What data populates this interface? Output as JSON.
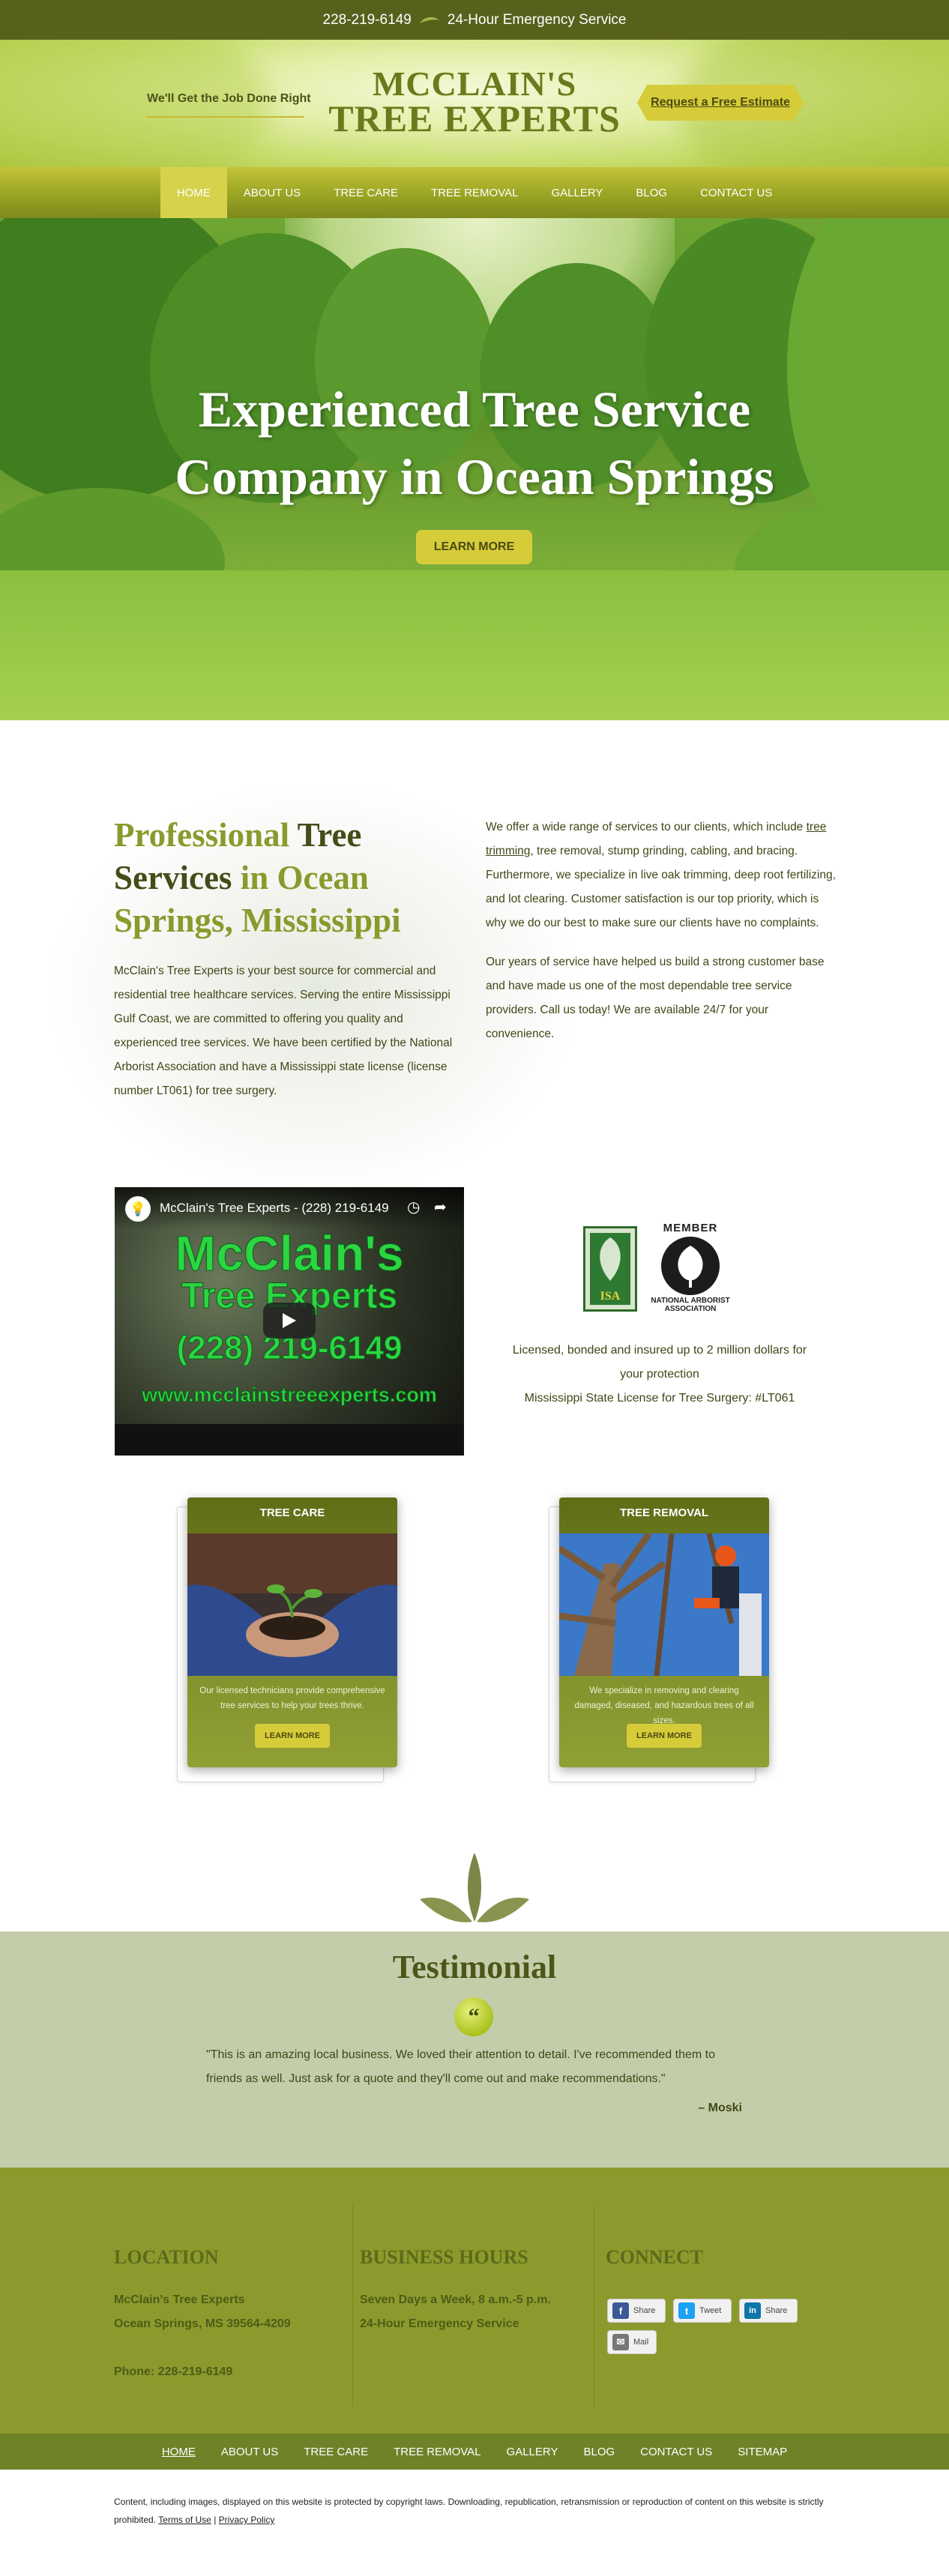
{
  "topbar": {
    "phone": "228-219-6149",
    "emergency": "24-Hour Emergency Service"
  },
  "header": {
    "tagline": "We'll Get the Job Done Right",
    "logo_line1": "MCCLAIN'S",
    "logo_line2": "TREE EXPERTS",
    "estimate_button": "Request a Free Estimate"
  },
  "nav": {
    "items": [
      {
        "label": "HOME",
        "active": true
      },
      {
        "label": "ABOUT US"
      },
      {
        "label": "TREE CARE"
      },
      {
        "label": "TREE REMOVAL"
      },
      {
        "label": "GALLERY"
      },
      {
        "label": "BLOG"
      },
      {
        "label": "CONTACT US"
      }
    ]
  },
  "hero": {
    "title_line1": "Experienced Tree Service",
    "title_line2": "Company in Ocean Springs",
    "button": "LEARN MORE"
  },
  "intro": {
    "heading_part1": "Professional ",
    "heading_part2": "Tree Services",
    "heading_part3": " in Ocean Springs, Mississippi",
    "left_paragraph": "McClain's Tree Experts is your best source for commercial and residential tree healthcare services. Serving the entire Mississippi Gulf Coast, we are committed to offering you quality and experienced tree services. We have been certified by the National Arborist Association and have a Mississippi state license (license number LT061) for tree surgery.",
    "right_p1_before": "We offer a wide range of services to our clients, which include ",
    "right_p1_link": "tree trimming",
    "right_p1_after": ", tree removal, stump grinding, cabling, and bracing. Furthermore, we specialize in live oak trimming, deep root fertilizing, and lot clearing. Customer satisfaction is our top priority, which is why we do our best to make sure our clients have no complaints.",
    "right_p2": "Our years of service have helped us build a strong customer base and have made us one of the most dependable tree service providers. Call us today! We are available 24/7 for your convenience."
  },
  "video": {
    "title": "McClain's Tree Experts - (228) 219-6149",
    "line1": "McClain's",
    "line2": "Tree Experts",
    "line3": "(228) 219-6149",
    "line4": "www.mcclainstreeexperts.com"
  },
  "badges": {
    "isa_label": "ISA",
    "naa_member": "MEMBER",
    "naa_caption_1": "NATIONAL ARBORIST",
    "naa_caption_2": "ASSOCIATION",
    "license_line1": "Licensed, bonded and insured up to 2 million dollars for",
    "license_line2": "your protection",
    "license_line3": "Mississippi State License for Tree Surgery: #LT061"
  },
  "cards": [
    {
      "title": "TREE CARE",
      "desc": "Our licensed technicians provide comprehensive tree services to help your trees thrive.",
      "button": "LEARN MORE"
    },
    {
      "title": "TREE REMOVAL",
      "desc": "We specialize in removing and clearing damaged, diseased, and hazardous trees of all sizes.",
      "button": "LEARN MORE"
    }
  ],
  "testimonial": {
    "title": "Testimonial",
    "quote": "\"This is an amazing local business. We loved their attention to detail. I've recommended them to friends as well. Just ask for a quote and they'll come out and make recommendations.\"",
    "author": "– Moski"
  },
  "footer": {
    "location_head": "LOCATION",
    "location_line1": "McClain's Tree Experts",
    "location_line2": "Ocean Springs, MS 39564-4209",
    "phone": "Phone: 228-219-6149",
    "hours_head": "BUSINESS HOURS",
    "hours_line1": "Seven Days a Week, 8 a.m.-5 p.m.",
    "hours_line2": "24-Hour Emergency Service",
    "connect_head": "CONNECT",
    "share": [
      {
        "label": "Share",
        "icon": "facebook-icon",
        "glyph": "f",
        "color": "#3b5998"
      },
      {
        "label": "Tweet",
        "icon": "twitter-icon",
        "glyph": "t",
        "color": "#1da1f2"
      },
      {
        "label": "Share",
        "icon": "linkedin-icon",
        "glyph": "in",
        "color": "#0e76a8"
      },
      {
        "label": "Mail",
        "icon": "mail-icon",
        "glyph": "✉",
        "color": "#777777"
      }
    ]
  },
  "bottom_nav": {
    "items": [
      {
        "label": "HOME",
        "active": true
      },
      {
        "label": "ABOUT US"
      },
      {
        "label": "TREE CARE"
      },
      {
        "label": "TREE REMOVAL"
      },
      {
        "label": "GALLERY"
      },
      {
        "label": "BLOG"
      },
      {
        "label": "CONTACT US"
      },
      {
        "label": "SITEMAP"
      }
    ]
  },
  "copyright": {
    "text": "Content, including images, displayed on this website is protected by copyright laws. Downloading, republication, retransmission or reproduction of content on this website is strictly prohibited.",
    "terms": "Terms of Use",
    "sep": "|",
    "privacy": "Privacy Policy"
  },
  "colors": {
    "olive_dark": "#58611c",
    "olive": "#8c9a2d",
    "gold": "#d6cc3a",
    "testimonial_bg": "#c4cda9"
  }
}
